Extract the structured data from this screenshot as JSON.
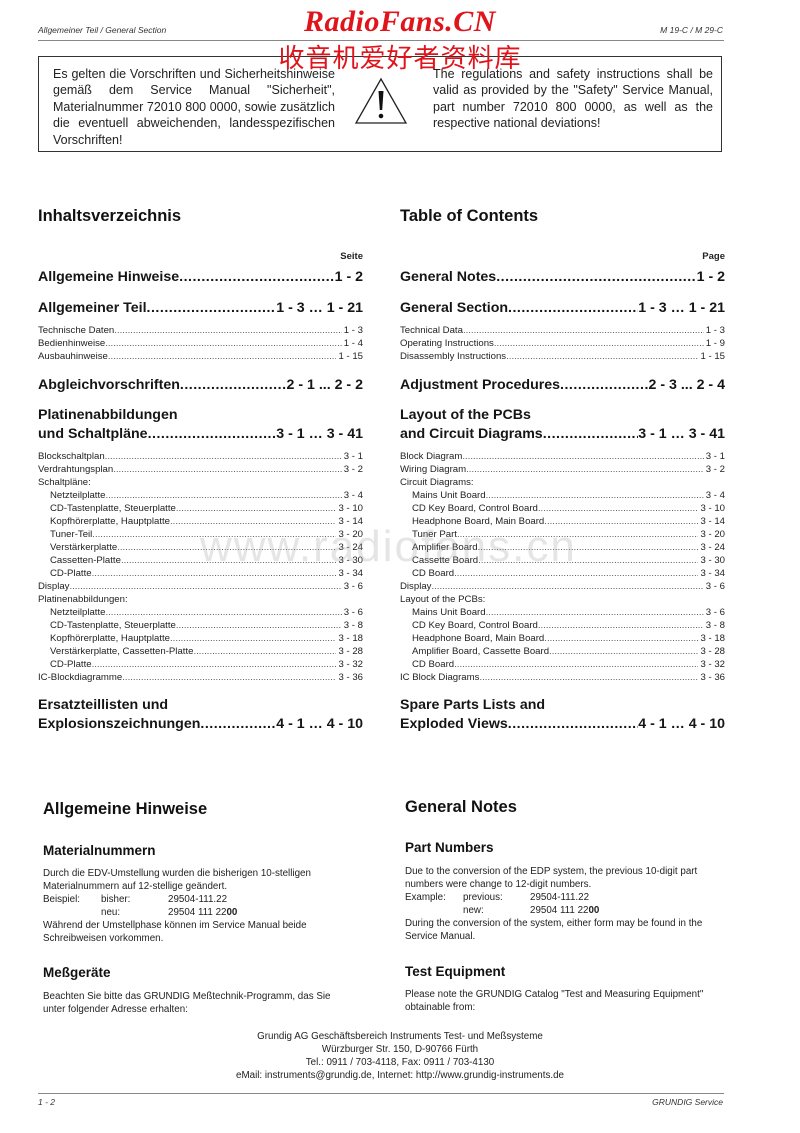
{
  "header": {
    "left": "Allgemeiner Teil / General Section",
    "right": "M 19-C / M 29-C"
  },
  "watermark": {
    "title": "RadioFans.CN",
    "subtitle_cn": "收音机爱好者资料库",
    "url": "www.radiofans.cn"
  },
  "safety": {
    "de": "Es gelten die Vorschriften und Sicherheitshinweise gemäß dem Service Manual \"Sicherheit\", Materialnummer 72010 800 0000, sowie zusätzlich die eventuell abweichenden, landesspezifischen Vorschriften!",
    "en": "The regulations and safety instructions shall be valid as provided by the \"Safety\" Service Manual, part number 72010 800 0000, as well as the respective national deviations!",
    "icon": "warning-triangle-icon"
  },
  "toc_de": {
    "title": "Inhaltsverzeichnis",
    "page_label": "Seite",
    "s1": {
      "label": "Allgemeine Hinweise ",
      "page": "1 - 2"
    },
    "s2": {
      "label": "Allgemeiner Teil ",
      "page": "1 - 3 … 1 - 21"
    },
    "s2_items": [
      {
        "label": "Technische Daten",
        "page": "1 - 3"
      },
      {
        "label": "Bedienhinweise",
        "page": "1 - 4"
      },
      {
        "label": "Ausbauhinweise",
        "page": "1 - 15"
      }
    ],
    "s3": {
      "label": "Abgleichvorschriften ",
      "page": "2 - 1 ... 2 - 2"
    },
    "s4": {
      "line1": "Platinenabbildungen",
      "label": "und Schaltpläne ",
      "page": "3 - 1 … 3 - 41"
    },
    "s4_items": [
      {
        "label": "Blockschaltplan",
        "page": "3 - 1",
        "indent": false
      },
      {
        "label": "Verdrahtungsplan",
        "page": "3 - 2",
        "indent": false
      },
      {
        "label": "Schaltpläne:",
        "page": "",
        "indent": false
      },
      {
        "label": "Netzteilplatte",
        "page": "3 - 4",
        "indent": true
      },
      {
        "label": "CD-Tastenplatte, Steuerplatte",
        "page": "3 - 10",
        "indent": true
      },
      {
        "label": "Kopfhörerplatte, Hauptplatte",
        "page": "3 - 14",
        "indent": true
      },
      {
        "label": "Tuner-Teil",
        "page": "3 - 20",
        "indent": true
      },
      {
        "label": "Verstärkerplatte",
        "page": "3 - 24",
        "indent": true
      },
      {
        "label": "Cassetten-Platte",
        "page": "3 - 30",
        "indent": true
      },
      {
        "label": "CD-Platte",
        "page": "3 - 34",
        "indent": true
      },
      {
        "label": "Display",
        "page": "3 - 6",
        "indent": false
      },
      {
        "label": "Platinenabbildungen:",
        "page": "",
        "indent": false
      },
      {
        "label": "Netzteilplatte",
        "page": "3 - 6",
        "indent": true
      },
      {
        "label": "CD-Tastenplatte, Steuerplatte",
        "page": "3 - 8",
        "indent": true
      },
      {
        "label": "Kopfhörerplatte, Hauptplatte",
        "page": "3 - 18",
        "indent": true
      },
      {
        "label": "Verstärkerplatte, Cassetten-Platte",
        "page": "3 - 28",
        "indent": true
      },
      {
        "label": "CD-Platte",
        "page": "3 - 32",
        "indent": true
      },
      {
        "label": "IC-Blockdiagramme",
        "page": "3 - 36",
        "indent": false
      }
    ],
    "s5": {
      "line1": "Ersatzteillisten und",
      "label": "Explosionszeichnungen ",
      "page": "4 - 1 … 4 - 10"
    }
  },
  "toc_en": {
    "title": "Table of Contents",
    "page_label": "Page",
    "s1": {
      "label": "General Notes",
      "page": "1 - 2"
    },
    "s2": {
      "label": "General Section",
      "page": "1 - 3 … 1 - 21"
    },
    "s2_items": [
      {
        "label": "Technical Data",
        "page": "1 - 3"
      },
      {
        "label": "Operating Instructions",
        "page": "1 - 9"
      },
      {
        "label": "Disassembly Instructions",
        "page": "1 - 15"
      }
    ],
    "s3": {
      "label": "Adjustment Procedures",
      "page": "2 - 3 ... 2 - 4"
    },
    "s4": {
      "line1": "Layout of the PCBs",
      "label": "and Circuit Diagrams ",
      "page": "3 - 1 … 3 - 41"
    },
    "s4_items": [
      {
        "label": "Block Diagram",
        "page": "3 - 1",
        "indent": false
      },
      {
        "label": "Wiring Diagram",
        "page": "3 - 2",
        "indent": false
      },
      {
        "label": "Circuit Diagrams:",
        "page": "",
        "indent": false
      },
      {
        "label": "Mains Unit Board",
        "page": "3 - 4",
        "indent": true
      },
      {
        "label": "CD Key Board, Control Board",
        "page": "3 - 10",
        "indent": true
      },
      {
        "label": "Headphone Board, Main Board",
        "page": "3 - 14",
        "indent": true
      },
      {
        "label": "Tuner Part",
        "page": "3 - 20",
        "indent": true
      },
      {
        "label": "Amplifier Board",
        "page": "3 - 24",
        "indent": true
      },
      {
        "label": "Cassette Board",
        "page": "3 - 30",
        "indent": true
      },
      {
        "label": "CD Board",
        "page": "3 - 34",
        "indent": true
      },
      {
        "label": "Display",
        "page": "3 - 6",
        "indent": false
      },
      {
        "label": "Layout of the PCBs:",
        "page": "",
        "indent": false
      },
      {
        "label": "Mains Unit Board",
        "page": "3 - 6",
        "indent": true
      },
      {
        "label": "CD Key Board, Control Board",
        "page": "3 - 8",
        "indent": true
      },
      {
        "label": "Headphone Board, Main Board",
        "page": "3 - 18",
        "indent": true
      },
      {
        "label": "Amplifier Board, Cassette Board",
        "page": "3 - 28",
        "indent": true
      },
      {
        "label": "CD Board",
        "page": "3 - 32",
        "indent": true
      },
      {
        "label": "IC Block Diagrams",
        "page": "3 - 36",
        "indent": false
      }
    ],
    "s5": {
      "line1": "Spare Parts Lists and",
      "label": "Exploded Views",
      "page": "4 - 1 … 4 - 10"
    }
  },
  "notes_de": {
    "title": "Allgemeine Hinweise",
    "part_heading": "Materialnummern",
    "part_text": "Durch die EDV-Umstellung wurden die bisherigen 10-stelligen Materialnummern auf 12-stellige geändert.",
    "example_label": "Beispiel:",
    "prev_label": "bisher:",
    "prev_value": "29504-111.22",
    "new_label": "neu:",
    "new_value_main": "29504 111 22",
    "new_value_bold": "00",
    "during_text": "Während der Umstellphase können im Service Manual beide Schreibweisen vorkommen.",
    "equip_heading": "Meßgeräte",
    "equip_text": "Beachten Sie bitte das GRUNDIG Meßtechnik-Programm, das Sie unter folgender Adresse erhalten:"
  },
  "notes_en": {
    "title": "General Notes",
    "part_heading": "Part Numbers",
    "part_text": "Due to the conversion of the EDP system, the previous 10-digit part numbers were change to 12-digit numbers.",
    "example_label": "Example:",
    "prev_label": "previous:",
    "prev_value": "29504-111.22",
    "new_label": "new:",
    "new_value_main": "29504 111 22",
    "new_value_bold": "00",
    "during_text": "During the conversion of the system, either form may be found in the Service Manual.",
    "equip_heading": "Test Equipment",
    "equip_text": "Please note the GRUNDIG Catalog \"Test and Measuring Equipment\" obtainable from:"
  },
  "address": {
    "line1": "Grundig AG Geschäftsbereich Instruments Test- und Meßsysteme",
    "line2": "Würzburger Str. 150, D-90766 Fürth",
    "line3": "Tel.: 0911 / 703-4118, Fax: 0911 / 703-4130",
    "line4": "eMail: instruments@grundig.de, Internet: http://www.grundig-instruments.de"
  },
  "footer": {
    "left": "1 - 2",
    "right": "GRUNDIG Service"
  }
}
